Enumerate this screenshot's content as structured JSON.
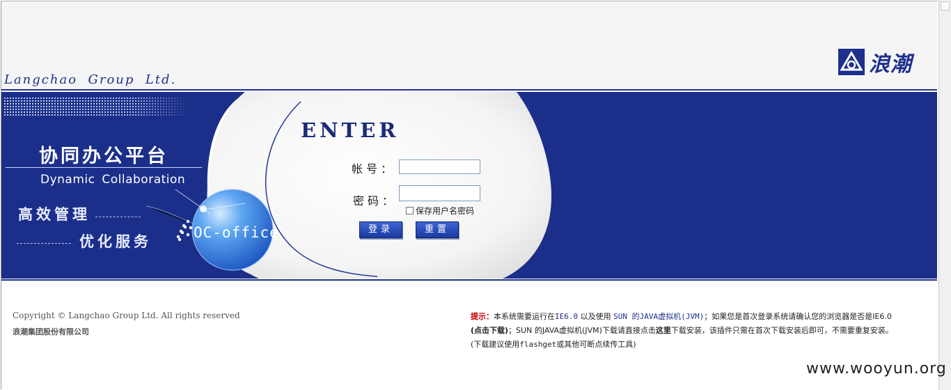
{
  "header": {
    "company_name": "Langchao  Group  Ltd.",
    "logo_text": "浪潮"
  },
  "banner": {
    "title_cn": "协同办公平台",
    "title_en": "Dynamic  Collaboration",
    "slogan_1": "高效管理",
    "slogan_2": "优化服务",
    "product_label": "OC-office"
  },
  "login": {
    "title": "ENTER",
    "username_label": "帐号：",
    "password_label": "密码：",
    "username_value": "",
    "password_value": "",
    "remember_label": "保存用户名密码",
    "remember_checked": false,
    "login_button": "登录",
    "reset_button": "重置"
  },
  "footer": {
    "copyright": "Copyright © Langchao Group Ltd. All rights reserved",
    "company_cn": "浪潮集团股份有限公司",
    "tip": {
      "label": "提示：",
      "p1": "本系统需要运行在",
      "ie": "IE6.0",
      "p2": " 以及使用 ",
      "jvm": "SUN 的JAVA虚拟机(JVM)",
      "p3": "；如果您是首次登录系统请确认您的浏览器是否是IE6.0",
      "p4": "(点击下载)",
      "p5": "；SUN 的JAVA虚拟机(JVM)下载请直接点击",
      "here": "这里",
      "p6": "下载安装，该插件只需在首次下载安装后即可，不需要重复安装。",
      "p7": "(下载建议使用",
      "flashget": "flashget",
      "p8": "或其他可断点续传工具)"
    }
  },
  "watermark": "www.wooyun.org",
  "colors": {
    "brand_blue": "#1b2f8a",
    "header_bg": "#f5f5f5",
    "tip_label": "#c00000"
  }
}
